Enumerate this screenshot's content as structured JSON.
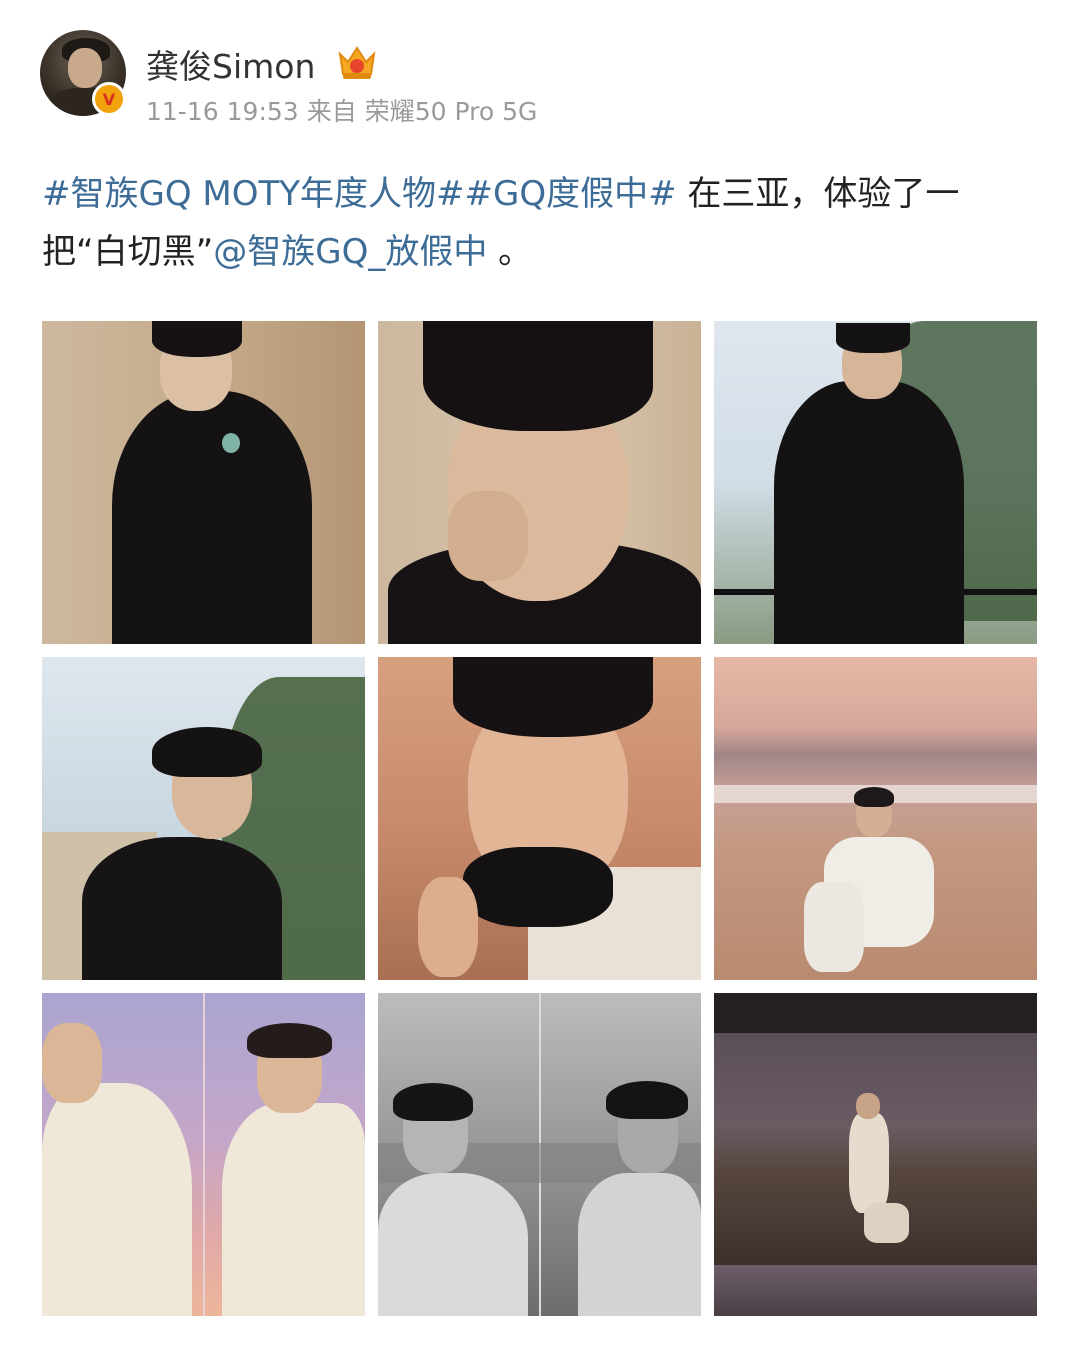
{
  "post": {
    "author": {
      "name": "龚俊Simon",
      "verified_badge_letter": "V",
      "badge_icon": "crown-badge-icon"
    },
    "meta": {
      "date": "11-16",
      "time": "19:53",
      "source_prefix": "来自",
      "device": "荣耀50 Pro 5G"
    },
    "text": {
      "topic1": "#智族GQ MOTY年度人物#",
      "topic2": "#GQ度假中#",
      "body1": " 在三亚，体验了一把“白切黑”",
      "mention": "@智族GQ_放假中",
      "body2": " 。"
    },
    "images": [
      {
        "index": 1,
        "description": "portrait-black-velvet-suit-brooch"
      },
      {
        "index": 2,
        "description": "closeup-hand-to-lips-rings"
      },
      {
        "index": 3,
        "description": "leaning-on-railing-trees"
      },
      {
        "index": 4,
        "description": "profile-against-sky-trees"
      },
      {
        "index": 5,
        "description": "holding-black-bow-sunset"
      },
      {
        "index": 6,
        "description": "sitting-chair-on-beach"
      },
      {
        "index": 7,
        "description": "split-purple-sunset-white-shirt"
      },
      {
        "index": 8,
        "description": "split-black-and-white-sea"
      },
      {
        "index": 9,
        "description": "walking-on-beach-tilted"
      }
    ]
  },
  "colors": {
    "link": "#3d6c97",
    "meta_text": "#9a9a9a",
    "badge_orange": "#f2a20c"
  }
}
